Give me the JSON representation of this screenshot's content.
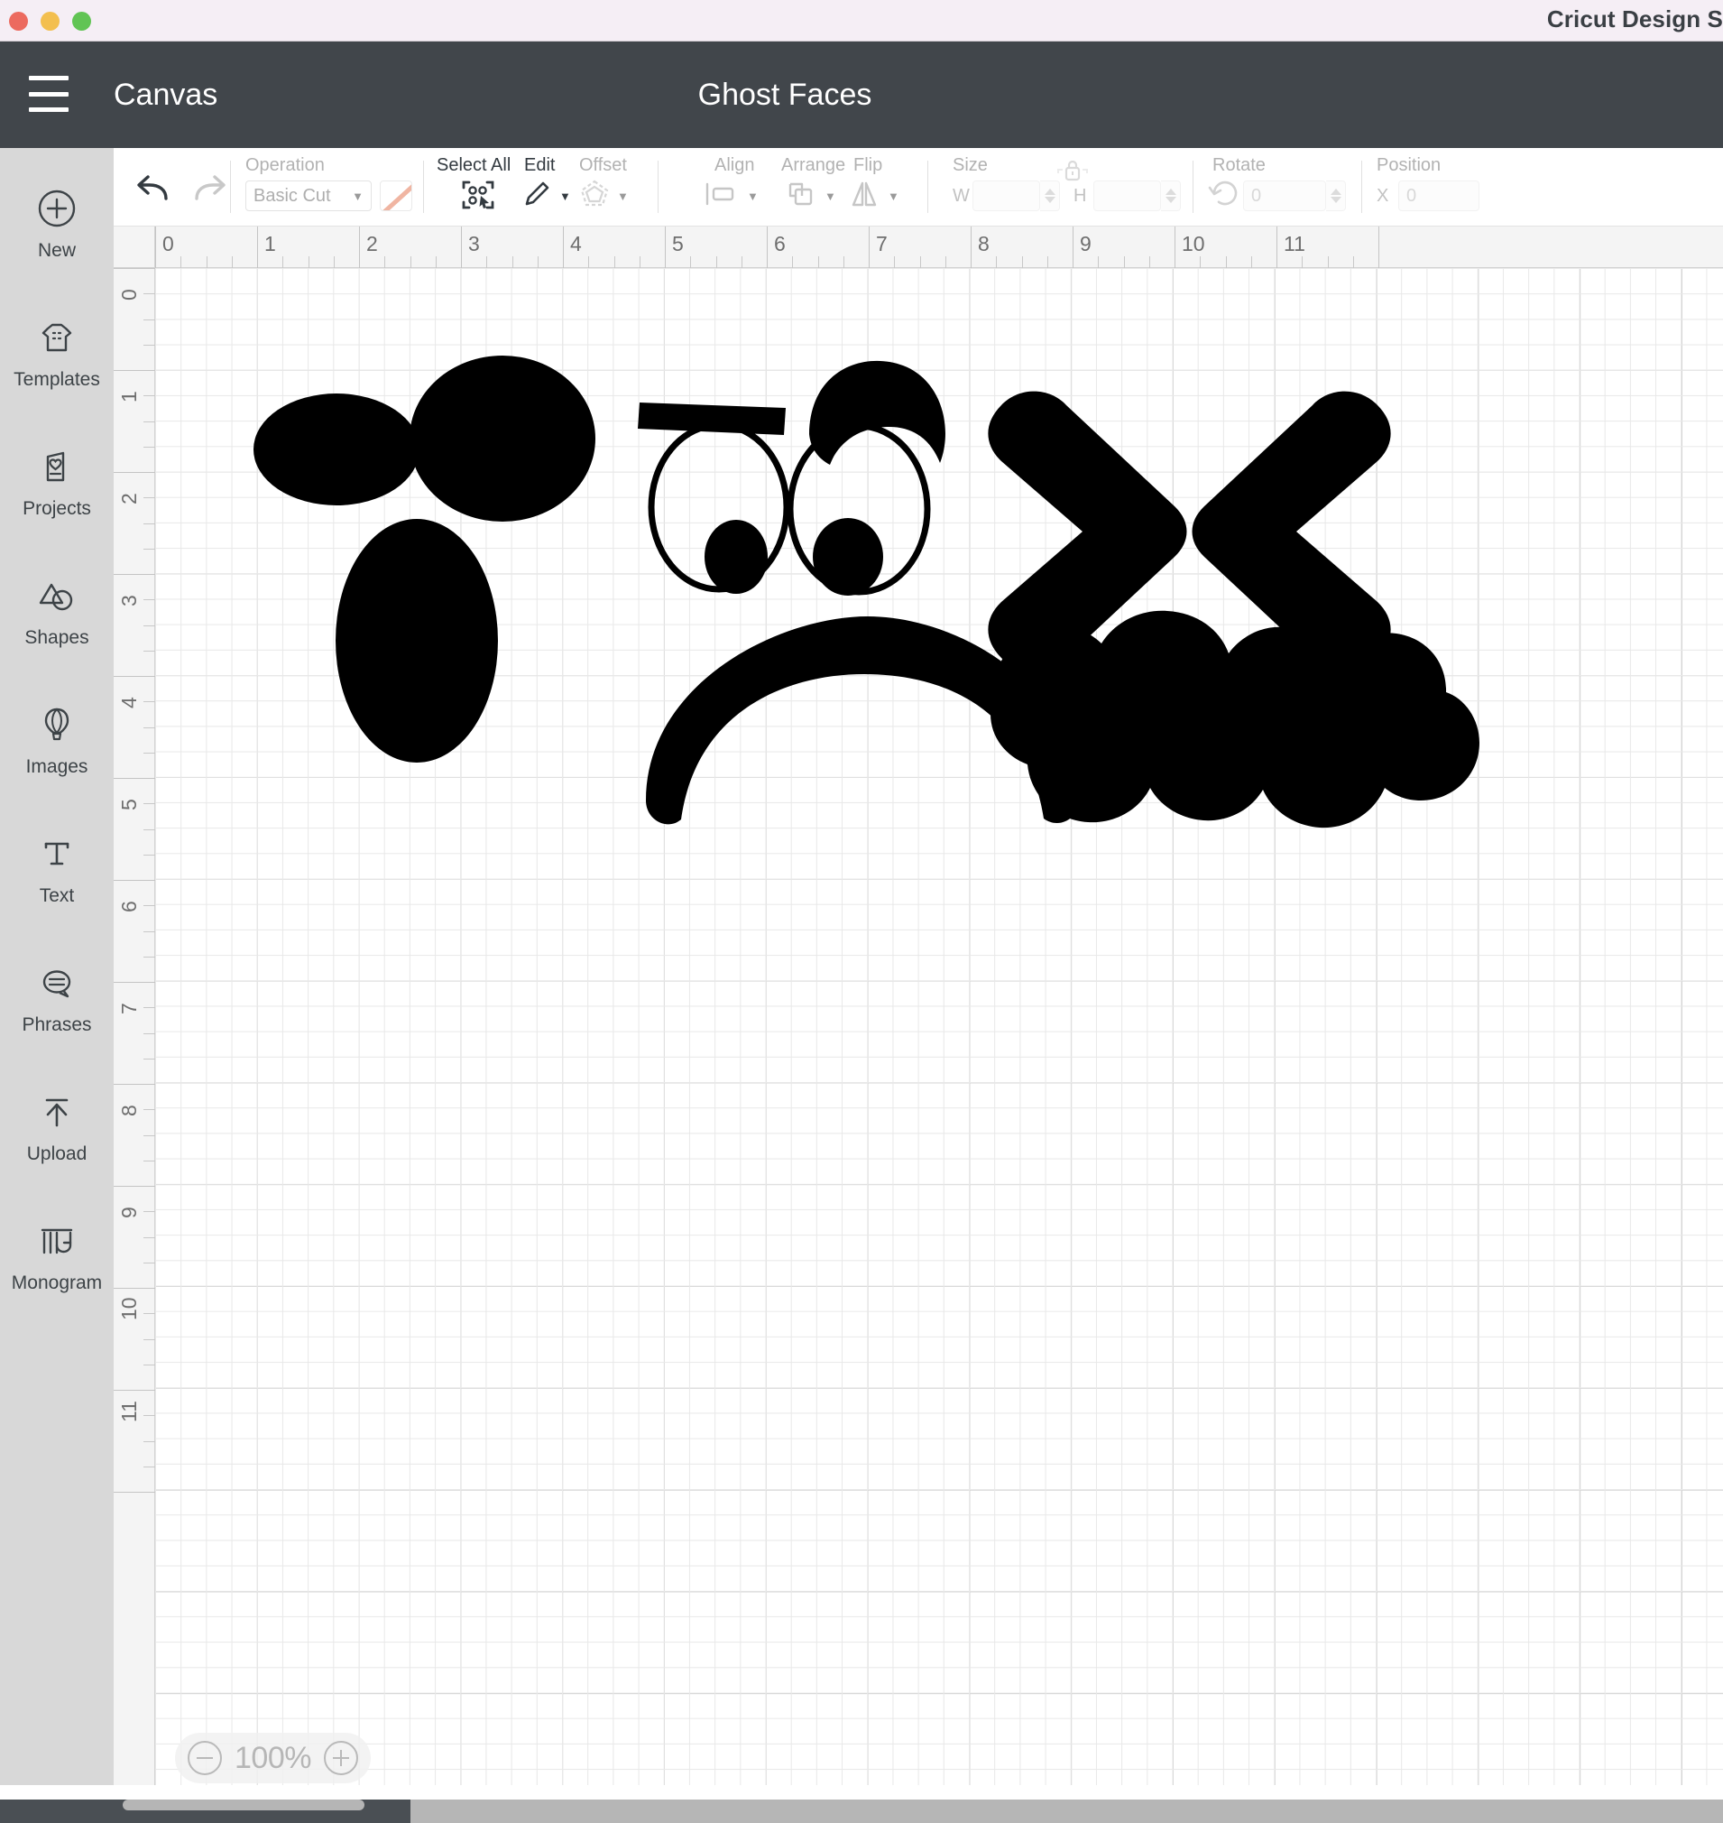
{
  "window": {
    "app_name": "Cricut Design S",
    "traffic_lights": [
      "close-red",
      "minimize-yellow",
      "zoom-green"
    ]
  },
  "header": {
    "menu_icon": "hamburger-icon",
    "canvas_label": "Canvas",
    "project_title": "Ghost Faces"
  },
  "sidebar": {
    "items": [
      {
        "label": "New",
        "icon": "plus-circle-icon"
      },
      {
        "label": "Templates",
        "icon": "tshirt-icon"
      },
      {
        "label": "Projects",
        "icon": "card-heart-icon"
      },
      {
        "label": "Shapes",
        "icon": "shapes-icon"
      },
      {
        "label": "Images",
        "icon": "hot-air-balloon-icon"
      },
      {
        "label": "Text",
        "icon": "text-t-icon"
      },
      {
        "label": "Phrases",
        "icon": "speech-bubble-icon"
      },
      {
        "label": "Upload",
        "icon": "upload-arrow-icon"
      },
      {
        "label": "Monogram",
        "icon": "monogram-mg-icon"
      }
    ]
  },
  "toolbar": {
    "undo_icon": "undo-arrow-icon",
    "redo_icon": "redo-arrow-icon",
    "operation": {
      "label": "Operation",
      "value": "Basic Cut",
      "caret": "▼",
      "swatch_color": "#f0b5a2"
    },
    "select_all": {
      "label": "Select All",
      "icon": "select-all-icon"
    },
    "edit": {
      "label": "Edit",
      "icon": "pencil-icon",
      "caret": "▼",
      "enabled": true
    },
    "offset": {
      "label": "Offset",
      "icon": "offset-pentagon-icon",
      "caret": "▼",
      "enabled": false
    },
    "align": {
      "label": "Align",
      "icon": "align-icon",
      "caret": "▼",
      "enabled": false
    },
    "arrange": {
      "label": "Arrange",
      "icon": "arrange-layers-icon",
      "caret": "▼",
      "enabled": false
    },
    "flip": {
      "label": "Flip",
      "icon": "flip-icon",
      "caret": "▼",
      "enabled": false
    },
    "size": {
      "label": "Size",
      "lock_icon": "lock-icon",
      "width_letter": "W",
      "width_value": "",
      "height_letter": "H",
      "height_value": ""
    },
    "rotate": {
      "label": "Rotate",
      "icon": "rotate-icon",
      "value": "0"
    },
    "position": {
      "label": "Position",
      "x_letter": "X",
      "x_value": "0"
    }
  },
  "canvas": {
    "ruler_h_labels": [
      "0",
      "1",
      "2",
      "3",
      "4",
      "5",
      "6",
      "7",
      "8",
      "9",
      "10",
      "11"
    ],
    "ruler_v_labels": [
      "0",
      "1",
      "2",
      "3",
      "4",
      "5",
      "6",
      "7",
      "8",
      "9",
      "10",
      "11"
    ],
    "zoom": {
      "value": "100%",
      "minus_icon": "minus-circle-icon",
      "plus_icon": "plus-circle-icon"
    },
    "artwork_title": "Ghost Faces",
    "shapes": [
      {
        "name": "face1-left-eye",
        "type": "ellipse-filled"
      },
      {
        "name": "face1-right-eye",
        "type": "circle-filled"
      },
      {
        "name": "face1-mouth",
        "type": "oval-filled"
      },
      {
        "name": "face2-left-eyebrow",
        "type": "bar-filled"
      },
      {
        "name": "face2-left-eye-outline",
        "type": "ellipse-outline"
      },
      {
        "name": "face2-left-pupil",
        "type": "ellipse-filled"
      },
      {
        "name": "face2-right-eyebrow",
        "type": "crescent-filled"
      },
      {
        "name": "face2-right-eye-outline",
        "type": "ellipse-outline"
      },
      {
        "name": "face2-right-pupil",
        "type": "ellipse-filled"
      },
      {
        "name": "face2-mouth",
        "type": "frown-arc-filled"
      },
      {
        "name": "face3-left-eye",
        "type": "chevron-right-filled"
      },
      {
        "name": "face3-right-eye",
        "type": "chevron-left-filled"
      },
      {
        "name": "face3-mouth",
        "type": "cloud-blob-filled"
      }
    ]
  },
  "colors": {
    "header_dark": "#41466b",
    "titlebar": "#f5eef5",
    "rail": "#d8d8d8",
    "artwork": "#000000"
  }
}
